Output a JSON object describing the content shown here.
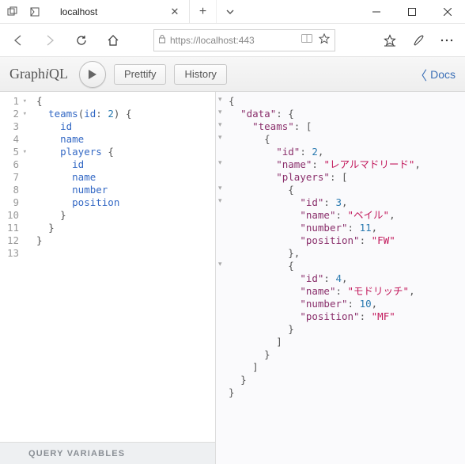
{
  "browser": {
    "tab_title": "localhost",
    "url_display": "https://localhost:443",
    "url_placeholder": "https://localhost:443"
  },
  "graphiql": {
    "logo_prefix": "Graph",
    "logo_italic": "i",
    "logo_suffix": "QL",
    "prettify": "Prettify",
    "history": "History",
    "docs": "Docs"
  },
  "query": {
    "line_numbers": [
      "1",
      "2",
      "3",
      "4",
      "5",
      "6",
      "7",
      "8",
      "9",
      "10",
      "11",
      "12",
      "13"
    ],
    "fold_lines": [
      1,
      2,
      5
    ],
    "lines": [
      {
        "indent": 0,
        "tokens": [
          {
            "t": "punc",
            "v": "{"
          }
        ]
      },
      {
        "indent": 1,
        "tokens": [
          {
            "t": "kw",
            "v": "teams"
          },
          {
            "t": "paren",
            "v": "("
          },
          {
            "t": "attr",
            "v": "id"
          },
          {
            "t": "punc",
            "v": ": "
          },
          {
            "t": "num",
            "v": "2"
          },
          {
            "t": "paren",
            "v": ")"
          },
          {
            "t": "punc",
            "v": " {"
          }
        ]
      },
      {
        "indent": 2,
        "tokens": [
          {
            "t": "attr",
            "v": "id"
          }
        ]
      },
      {
        "indent": 2,
        "tokens": [
          {
            "t": "attr",
            "v": "name"
          }
        ]
      },
      {
        "indent": 2,
        "tokens": [
          {
            "t": "kw",
            "v": "players"
          },
          {
            "t": "punc",
            "v": " {"
          }
        ]
      },
      {
        "indent": 3,
        "tokens": [
          {
            "t": "attr",
            "v": "id"
          }
        ]
      },
      {
        "indent": 3,
        "tokens": [
          {
            "t": "attr",
            "v": "name"
          }
        ]
      },
      {
        "indent": 3,
        "tokens": [
          {
            "t": "attr",
            "v": "number"
          }
        ]
      },
      {
        "indent": 3,
        "tokens": [
          {
            "t": "attr",
            "v": "position"
          }
        ]
      },
      {
        "indent": 2,
        "tokens": [
          {
            "t": "punc",
            "v": "}"
          }
        ]
      },
      {
        "indent": 1,
        "tokens": [
          {
            "t": "punc",
            "v": "}"
          }
        ]
      },
      {
        "indent": 0,
        "tokens": [
          {
            "t": "punc",
            "v": "}"
          }
        ]
      },
      {
        "indent": 0,
        "tokens": []
      }
    ]
  },
  "result": {
    "fold_rows": [
      0,
      1,
      2,
      3,
      5,
      7,
      8,
      13
    ],
    "lines": [
      {
        "indent": 0,
        "tokens": [
          {
            "t": "punc",
            "v": "{"
          }
        ]
      },
      {
        "indent": 1,
        "tokens": [
          {
            "t": "key",
            "v": "\"data\""
          },
          {
            "t": "punc",
            "v": ": {"
          }
        ]
      },
      {
        "indent": 2,
        "tokens": [
          {
            "t": "key",
            "v": "\"teams\""
          },
          {
            "t": "punc",
            "v": ": ["
          }
        ]
      },
      {
        "indent": 3,
        "tokens": [
          {
            "t": "punc",
            "v": "{"
          }
        ]
      },
      {
        "indent": 4,
        "tokens": [
          {
            "t": "key",
            "v": "\"id\""
          },
          {
            "t": "punc",
            "v": ": "
          },
          {
            "t": "rnum",
            "v": "2"
          },
          {
            "t": "punc",
            "v": ","
          }
        ]
      },
      {
        "indent": 4,
        "tokens": [
          {
            "t": "key",
            "v": "\"name\""
          },
          {
            "t": "punc",
            "v": ": "
          },
          {
            "t": "str",
            "v": "\"レアルマドリード\""
          },
          {
            "t": "punc",
            "v": ","
          }
        ]
      },
      {
        "indent": 4,
        "tokens": [
          {
            "t": "key",
            "v": "\"players\""
          },
          {
            "t": "punc",
            "v": ": ["
          }
        ]
      },
      {
        "indent": 5,
        "tokens": [
          {
            "t": "punc",
            "v": "{"
          }
        ]
      },
      {
        "indent": 6,
        "tokens": [
          {
            "t": "key",
            "v": "\"id\""
          },
          {
            "t": "punc",
            "v": ": "
          },
          {
            "t": "rnum",
            "v": "3"
          },
          {
            "t": "punc",
            "v": ","
          }
        ]
      },
      {
        "indent": 6,
        "tokens": [
          {
            "t": "key",
            "v": "\"name\""
          },
          {
            "t": "punc",
            "v": ": "
          },
          {
            "t": "str",
            "v": "\"ベイル\""
          },
          {
            "t": "punc",
            "v": ","
          }
        ]
      },
      {
        "indent": 6,
        "tokens": [
          {
            "t": "key",
            "v": "\"number\""
          },
          {
            "t": "punc",
            "v": ": "
          },
          {
            "t": "rnum",
            "v": "11"
          },
          {
            "t": "punc",
            "v": ","
          }
        ]
      },
      {
        "indent": 6,
        "tokens": [
          {
            "t": "key",
            "v": "\"position\""
          },
          {
            "t": "punc",
            "v": ": "
          },
          {
            "t": "str",
            "v": "\"FW\""
          }
        ]
      },
      {
        "indent": 5,
        "tokens": [
          {
            "t": "punc",
            "v": "},"
          }
        ]
      },
      {
        "indent": 5,
        "tokens": [
          {
            "t": "punc",
            "v": "{"
          }
        ]
      },
      {
        "indent": 6,
        "tokens": [
          {
            "t": "key",
            "v": "\"id\""
          },
          {
            "t": "punc",
            "v": ": "
          },
          {
            "t": "rnum",
            "v": "4"
          },
          {
            "t": "punc",
            "v": ","
          }
        ]
      },
      {
        "indent": 6,
        "tokens": [
          {
            "t": "key",
            "v": "\"name\""
          },
          {
            "t": "punc",
            "v": ": "
          },
          {
            "t": "str",
            "v": "\"モドリッチ\""
          },
          {
            "t": "punc",
            "v": ","
          }
        ]
      },
      {
        "indent": 6,
        "tokens": [
          {
            "t": "key",
            "v": "\"number\""
          },
          {
            "t": "punc",
            "v": ": "
          },
          {
            "t": "rnum",
            "v": "10"
          },
          {
            "t": "punc",
            "v": ","
          }
        ]
      },
      {
        "indent": 6,
        "tokens": [
          {
            "t": "key",
            "v": "\"position\""
          },
          {
            "t": "punc",
            "v": ": "
          },
          {
            "t": "str",
            "v": "\"MF\""
          }
        ]
      },
      {
        "indent": 5,
        "tokens": [
          {
            "t": "punc",
            "v": "}"
          }
        ]
      },
      {
        "indent": 4,
        "tokens": [
          {
            "t": "punc",
            "v": "]"
          }
        ]
      },
      {
        "indent": 3,
        "tokens": [
          {
            "t": "punc",
            "v": "}"
          }
        ]
      },
      {
        "indent": 2,
        "tokens": [
          {
            "t": "punc",
            "v": "]"
          }
        ]
      },
      {
        "indent": 1,
        "tokens": [
          {
            "t": "punc",
            "v": "}"
          }
        ]
      },
      {
        "indent": 0,
        "tokens": [
          {
            "t": "punc",
            "v": "}"
          }
        ]
      }
    ]
  },
  "vars_label": "QUERY VARIABLES"
}
